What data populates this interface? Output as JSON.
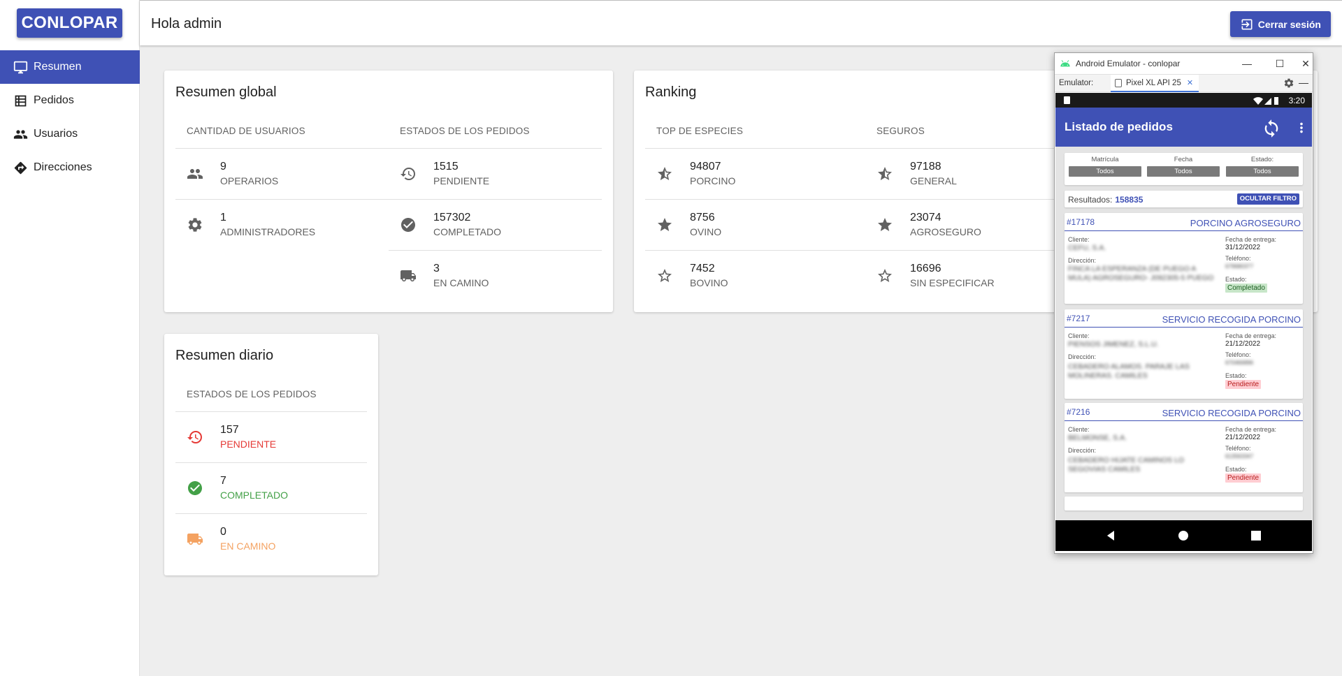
{
  "app": {
    "logo": "CONLOPAR",
    "greeting": "Hola admin",
    "logout_label": "Cerrar sesión"
  },
  "sidebar": {
    "items": [
      {
        "label": "Resumen",
        "icon": "monitor-icon",
        "active": true
      },
      {
        "label": "Pedidos",
        "icon": "list-icon",
        "active": false
      },
      {
        "label": "Usuarios",
        "icon": "people-icon",
        "active": false
      },
      {
        "label": "Direcciones",
        "icon": "directions-icon",
        "active": false
      }
    ]
  },
  "global": {
    "title": "Resumen global",
    "users_header": "CANTIDAD DE USUARIOS",
    "orders_header": "ESTADOS DE LOS PEDIDOS",
    "users": [
      {
        "value": "9",
        "label": "OPERARIOS",
        "icon": "people-icon"
      },
      {
        "value": "1",
        "label": "ADMINISTRADORES",
        "icon": "gear-icon"
      }
    ],
    "orders": [
      {
        "value": "1515",
        "label": "PENDIENTE",
        "icon": "history-icon"
      },
      {
        "value": "157302",
        "label": "COMPLETADO",
        "icon": "check-circle-icon"
      },
      {
        "value": "3",
        "label": "EN CAMINO",
        "icon": "truck-icon"
      }
    ]
  },
  "ranking": {
    "title": "Ranking",
    "species_header": "TOP DE ESPECIES",
    "insurance_header": "SEGUROS",
    "species": [
      {
        "value": "94807",
        "label": "PORCINO",
        "icon": "star-half-icon"
      },
      {
        "value": "8756",
        "label": "OVINO",
        "icon": "star-icon"
      },
      {
        "value": "7452",
        "label": "BOVINO",
        "icon": "star-outline-icon"
      }
    ],
    "insurance": [
      {
        "value": "97188",
        "label": "GENERAL",
        "icon": "star-half-icon"
      },
      {
        "value": "23074",
        "label": "AGROSEGURO",
        "icon": "star-icon"
      },
      {
        "value": "16696",
        "label": "SIN ESPECIFICAR",
        "icon": "star-outline-icon"
      }
    ]
  },
  "daily": {
    "title": "Resumen diario",
    "orders_header": "ESTADOS DE LOS PEDIDOS",
    "orders": [
      {
        "value": "157",
        "label": "PENDIENTE",
        "icon": "history-icon",
        "color": "#e53935"
      },
      {
        "value": "7",
        "label": "COMPLETADO",
        "icon": "check-circle-icon",
        "color": "#43a047"
      },
      {
        "value": "0",
        "label": "EN CAMINO",
        "icon": "truck-icon",
        "color": "#f4a261"
      }
    ]
  },
  "emulator": {
    "window_title": "Android Emulator - conlopar",
    "emulator_label": "Emulator:",
    "device_tab": "Pixel XL API 25",
    "phone": {
      "time": "3:20",
      "appbar_title": "Listado de pedidos",
      "filters": [
        {
          "label": "Matrícula",
          "value": "Todos"
        },
        {
          "label": "Fecha",
          "value": "Todos"
        },
        {
          "label": "Estado:",
          "value": "Todos"
        }
      ],
      "results_label": "Resultados:",
      "results_value": "158835",
      "hide_filter": "OCULTAR FILTRO",
      "field_labels": {
        "client": "Cliente:",
        "address": "Dirección:",
        "date": "Fecha de entrega:",
        "phone": "Teléfono:",
        "state": "Estado:"
      },
      "orders": [
        {
          "id": "#17178",
          "type": "PORCINO AGROSEGURO",
          "client": "CEFU, S.A.",
          "address": "FINCA LA ESPERANZA (DE PUEGO A MULA) AGROSEGURO- J092305-5 PUEGO",
          "date": "31/12/2022",
          "phone": "679680377",
          "state": "Completado",
          "state_kind": "ok"
        },
        {
          "id": "#7217",
          "type": "SERVICIO RECOGIDA PORCINO",
          "client": "PIENSOS JIMENEZ, S.L.U.",
          "address": "CEBADERO ALAMOS. PARAJE LAS MOLINERAS. CAMILES",
          "date": "21/12/2022",
          "phone": "670466896",
          "state": "Pendiente",
          "state_kind": "pend"
        },
        {
          "id": "#7216",
          "type": "SERVICIO RECOGIDA PORCINO",
          "client": "BELMONSE, S.A.",
          "address": "CEBADERO HIJATE CAMINOS LO SEGOVIAS CAMILES",
          "date": "21/12/2022",
          "phone": "613563347",
          "state": "Pendiente",
          "state_kind": "pend"
        }
      ]
    }
  }
}
